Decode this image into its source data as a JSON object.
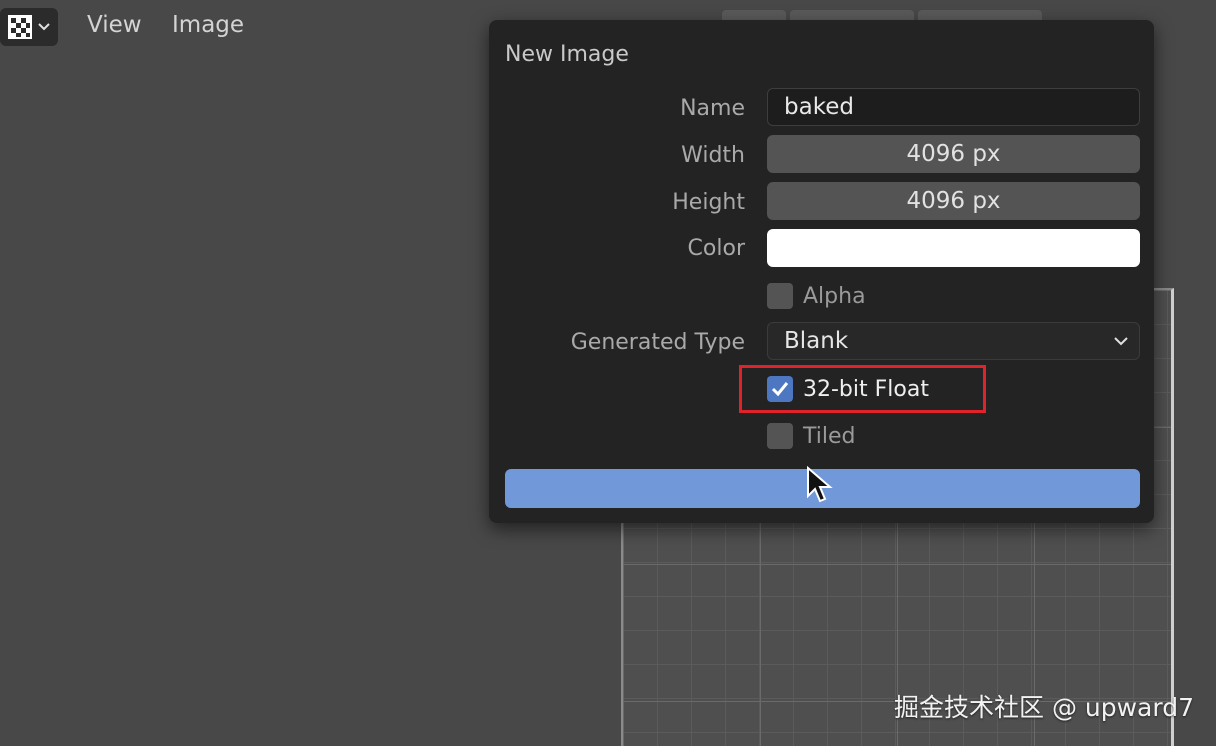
{
  "header": {
    "editor_icon": "image-editor-icon",
    "menus": [
      "View",
      "Image"
    ]
  },
  "dialog": {
    "title": "New Image",
    "name_label": "Name",
    "name_value": "baked",
    "width_label": "Width",
    "width_value": "4096 px",
    "height_label": "Height",
    "height_value": "4096 px",
    "color_label": "Color",
    "color_value": "#ffffff",
    "alpha_label": "Alpha",
    "alpha_checked": false,
    "generated_type_label": "Generated Type",
    "generated_type_value": "Blank",
    "float_label": "32-bit Float",
    "float_checked": true,
    "tiled_label": "Tiled",
    "tiled_checked": false,
    "ok_label": ""
  },
  "colors": {
    "accent": "#7199d9",
    "checkbox_checked": "#4d77c1",
    "highlight": "#e0222a"
  },
  "watermark": "掘金技术社区 @ upward7"
}
